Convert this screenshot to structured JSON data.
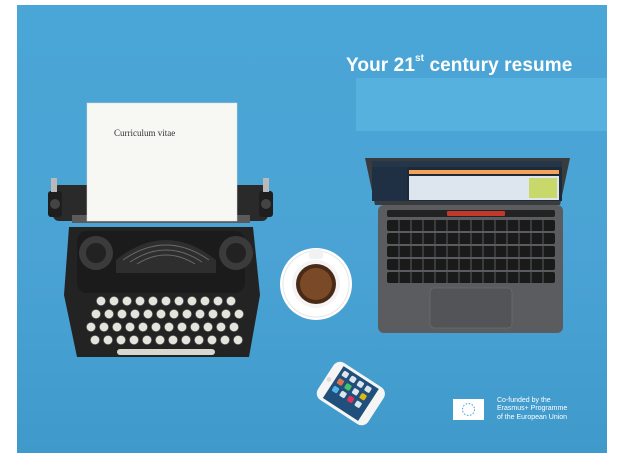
{
  "headline": {
    "before": "Your 21",
    "superscript": "st",
    "after": " century resume"
  },
  "paper_text": "Curriculum vitae",
  "eu": {
    "lines": [
      "Co-funded by the",
      "Erasmus+ Programme",
      "of the European Union"
    ]
  },
  "colors": {
    "background": "#4aa6d6",
    "text": "#ffffff"
  }
}
